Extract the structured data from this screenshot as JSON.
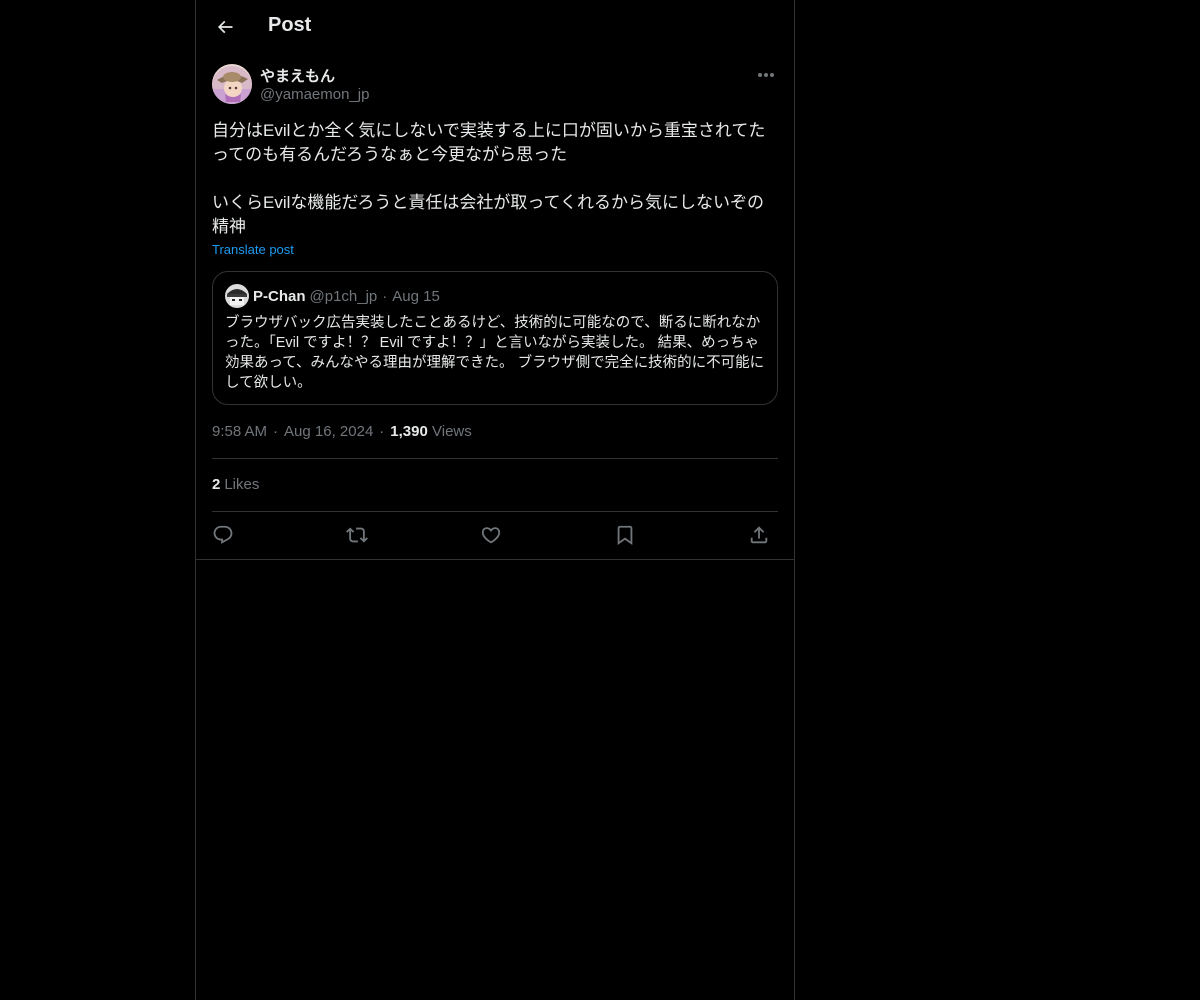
{
  "header": {
    "title": "Post",
    "back_icon": "arrow-left-icon"
  },
  "author": {
    "display_name": "やまえもん",
    "handle": "@yamaemon_jp",
    "more_icon": "more-horizontal-icon"
  },
  "post": {
    "paragraphs": [
      "自分はEvilとか全く気にしないで実装する上に口が固いから重宝されてたってのも有るんだろうなぁと今更ながら思った",
      "いくらEvilな機能だろうと責任は会社が取ってくれるから気にしないぞの精神"
    ],
    "translate_label": "Translate post"
  },
  "quote": {
    "display_name": "P-Chan",
    "handle": "@p1ch_jp",
    "dot": "·",
    "date": "Aug 15",
    "text": "ブラウザバック広告実装したことあるけど、技術的に可能なので、断るに断れなかった。「Evil ですよ！？ Evil ですよ！？」と言いながら実装した。 結果、めっちゃ効果あって、みんなやる理由が理解できた。 ブラウザ側で完全に技術的に不可能にして欲しい。"
  },
  "meta": {
    "time": "9:58 AM",
    "dot": "·",
    "date": "Aug 16, 2024",
    "views_count": "1,390",
    "views_label": "Views"
  },
  "likes": {
    "count": "2",
    "label": "Likes"
  },
  "actions": {
    "icons": [
      "reply-icon",
      "repost-icon",
      "like-icon",
      "bookmark-icon",
      "share-icon"
    ]
  },
  "colors": {
    "background": "#000000",
    "text": "#e7e9ea",
    "muted": "#71767b",
    "border": "#2f3336",
    "link": "#1d9bf0"
  }
}
